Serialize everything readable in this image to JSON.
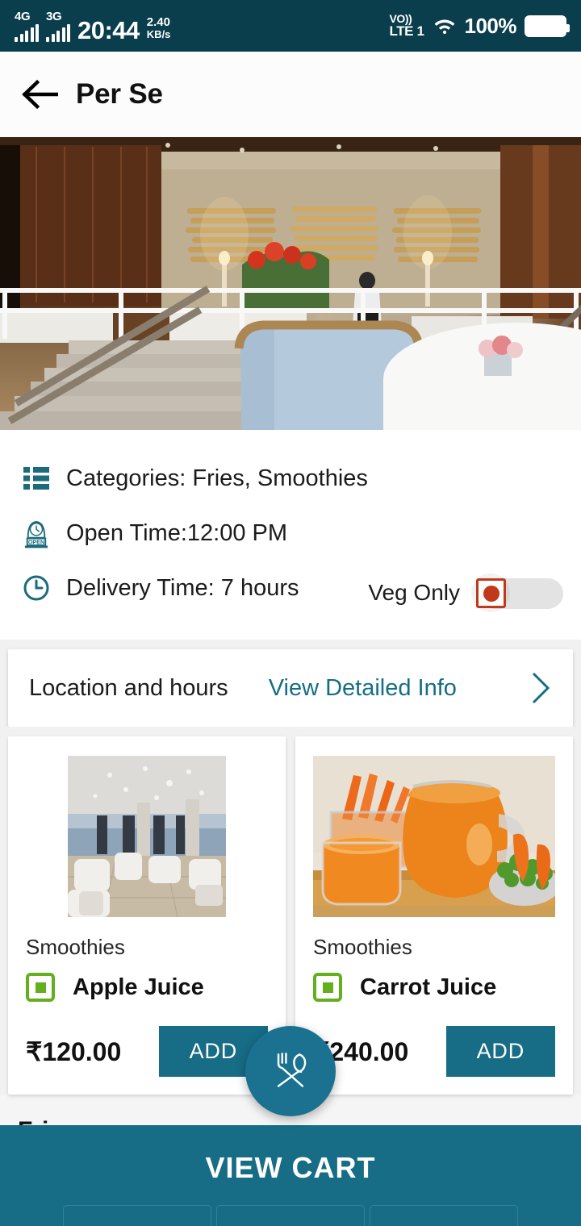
{
  "status_bar": {
    "network_1": "4G",
    "network_2": "3G",
    "time": "20:44",
    "data_speed_value": "2.40",
    "data_speed_unit": "KB/s",
    "volte_top": "VO))",
    "volte_bottom": "LTE 1",
    "battery_percent": "100%",
    "wifi_icon": "wifi-icon",
    "battery_icon": "battery-full-icon"
  },
  "app_bar": {
    "back_icon": "back-arrow-icon",
    "title": "Per Se"
  },
  "hero": {
    "alt": "restaurant-interior-banner"
  },
  "info": {
    "categories_icon": "list-categories-icon",
    "categories": "Categories: Fries, Smoothies",
    "open_time_icon": "open-sign-clock-icon",
    "open_time": "Open Time:12:00 PM",
    "delivery_icon": "clock-icon",
    "delivery_time": "Delivery Time: 7 hours",
    "veg_only_label": "Veg Only",
    "veg_only_state": "off"
  },
  "location_card": {
    "title": "Location and hours",
    "link": "View Detailed Info",
    "chevron_icon": "chevron-right-icon"
  },
  "products": [
    {
      "category": "Smoothies",
      "name": "Apple Juice",
      "price": "₹120.00",
      "add_label": "ADD",
      "diet": "veg",
      "thumb": "restaurant-interior-thumb"
    },
    {
      "category": "Smoothies",
      "name": "Carrot Juice",
      "price": "₹240.00",
      "add_label": "ADD",
      "diet": "veg",
      "thumb": "carrot-juice-thumb"
    }
  ],
  "section": {
    "title": "Fries",
    "partial_item_diet": "non-veg"
  },
  "fab": {
    "icon": "fork-and-spoon-icon"
  },
  "bottom_bar": {
    "label": "VIEW CART"
  },
  "colors": {
    "status_bar_bg": "#0a3e4c",
    "accent_teal": "#176c86",
    "link_teal": "#156e84",
    "veg_green": "#63af1d",
    "nonveg_red": "#c0291b"
  }
}
